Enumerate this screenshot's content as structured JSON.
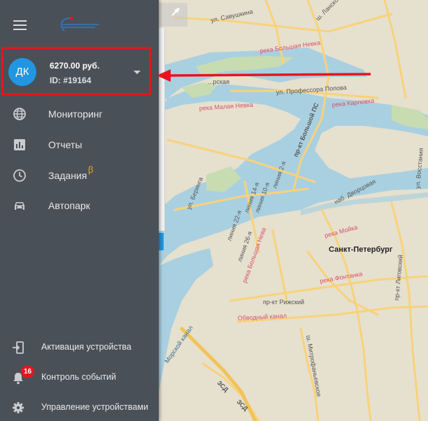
{
  "map": {
    "streets": [
      {
        "id": "savushkina",
        "text": "ул. Савушкина"
      },
      {
        "id": "lanskoe",
        "text": "ш. Ланское"
      },
      {
        "id": "bolshaya_nevka",
        "text": "река Большая Невка"
      },
      {
        "id": "maritime_prosp",
        "text": "...рская"
      },
      {
        "id": "popova",
        "text": "ул. Профессора Попова"
      },
      {
        "id": "karpovka",
        "text": "река Карповка"
      },
      {
        "id": "malaya_nevka",
        "text": "река Малая Невка"
      },
      {
        "id": "bolshoy_ps",
        "text": "пр-кт Большой ПС"
      },
      {
        "id": "beringa",
        "text": "ул. Беринга"
      },
      {
        "id": "liniya_10",
        "text": "линия 10-я"
      },
      {
        "id": "liniya_14",
        "text": "линия 14-я"
      },
      {
        "id": "liniya_2",
        "text": "линия 2-я"
      },
      {
        "id": "liniya_22",
        "text": "линия 22-я"
      },
      {
        "id": "liniya_26",
        "text": "линия 26-я"
      },
      {
        "id": "dvortsovaya",
        "text": "наб. Дворцовая"
      },
      {
        "id": "moyka",
        "text": "река Мойка"
      },
      {
        "id": "bolshaya_neva",
        "text": "река Большая Нева"
      },
      {
        "id": "fontanka",
        "text": "река Фонтанка"
      },
      {
        "id": "rizhsky",
        "text": "пр-кт Рижский"
      },
      {
        "id": "obvodny",
        "text": "Обводный канал"
      },
      {
        "id": "mitrofanievskoe",
        "text": "ш. Митрофаньевское"
      },
      {
        "id": "vosstaniya",
        "text": "ул. Восстания"
      },
      {
        "id": "ligovsky",
        "text": "пр-кт Лиговский"
      },
      {
        "id": "morskoy_kanal",
        "text": "Морской канал"
      },
      {
        "id": "zsd1",
        "text": "ЗСД"
      },
      {
        "id": "zsd2",
        "text": "ЗСД"
      }
    ],
    "city_label": "Санкт-Петербург"
  },
  "sidebar": {
    "account": {
      "initials": "ДК",
      "balance": "6270.00 руб.",
      "id_label": "ID: #19164"
    },
    "nav": [
      {
        "label": "Мониторинг",
        "icon": "globe-icon"
      },
      {
        "label": "Отчеты",
        "icon": "bar-chart-icon"
      },
      {
        "label": "Задания",
        "icon": "clock-icon",
        "beta": "β"
      },
      {
        "label": "Автопарк",
        "icon": "car-icon"
      }
    ],
    "bottom": [
      {
        "label": "Активация устройства",
        "icon": "device-login-icon"
      },
      {
        "label": "Контроль событий",
        "icon": "bell-icon",
        "badge": "16"
      },
      {
        "label": "Управление устройствами",
        "icon": "gear-icon"
      }
    ]
  },
  "colors": {
    "sidebar_bg": "#4a5057",
    "avatar": "#2196e3",
    "highlight": "#e8141c",
    "beta": "#f2a51a",
    "water": "#a9d0e0",
    "road": "#f8d27a",
    "land": "#e6e0cf"
  }
}
